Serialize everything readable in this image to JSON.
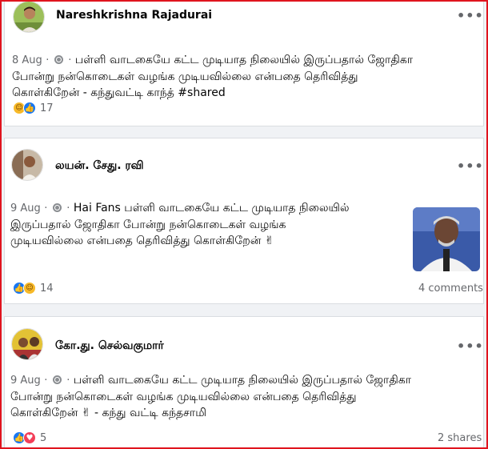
{
  "posts": [
    {
      "author": "Nareshkrishna Rajadurai",
      "date": "8 Aug",
      "sep": "·",
      "text_lines": [
        "பள்ளி வாடகையே கட்ட முடியாத நிலையில் இருப்பதால் ஜோதிகா",
        "போன்று நன்கொடைகள் வழங்க முடியவில்லை என்பதை தெரிவித்து",
        "கொள்கிறேன் - கந்துவட்டி காந்த் #shared"
      ],
      "reaction_count": "17",
      "reactions": [
        "haha-icon",
        "like-icon"
      ],
      "more_label": "•••"
    },
    {
      "author": "லயன். சேது. ரவி",
      "date": "9 Aug",
      "sep": "·",
      "text_lines": [
        "Hai Fans பள்ளி வாடகையே கட்ட முடியாத நிலையில்",
        "இருப்பதால் ஜோதிகா போன்று நன்கொடைகள் வழங்க",
        "முடியவில்லை என்பதை தெரிவித்து கொள்கிறேன் ✌"
      ],
      "reaction_count": "14",
      "reactions": [
        "like-icon",
        "haha-icon"
      ],
      "comments": "4 comments",
      "more_label": "•••"
    },
    {
      "author": "கோ.து. செல்வகுமார்",
      "date": "9 Aug",
      "sep": "·",
      "text_lines": [
        "பள்ளி வாடகையே கட்ட முடியாத நிலையில் இருப்பதால் ஜோதிகா",
        "போன்று நன்கொடைகள் வழங்க முடியவில்லை என்பதை தெரிவித்து",
        "கொள்கிறேன் ✌ - கந்து வட்டி கந்தசாமி"
      ],
      "reaction_count": "5",
      "reactions": [
        "like-icon",
        "love-icon"
      ],
      "shares": "2 shares",
      "more_label": "•••"
    }
  ],
  "colors": {
    "frame": "#e0141e",
    "like": "#1877f2",
    "haha": "#f7b928",
    "love": "#f33e58",
    "muted": "#65676b"
  }
}
